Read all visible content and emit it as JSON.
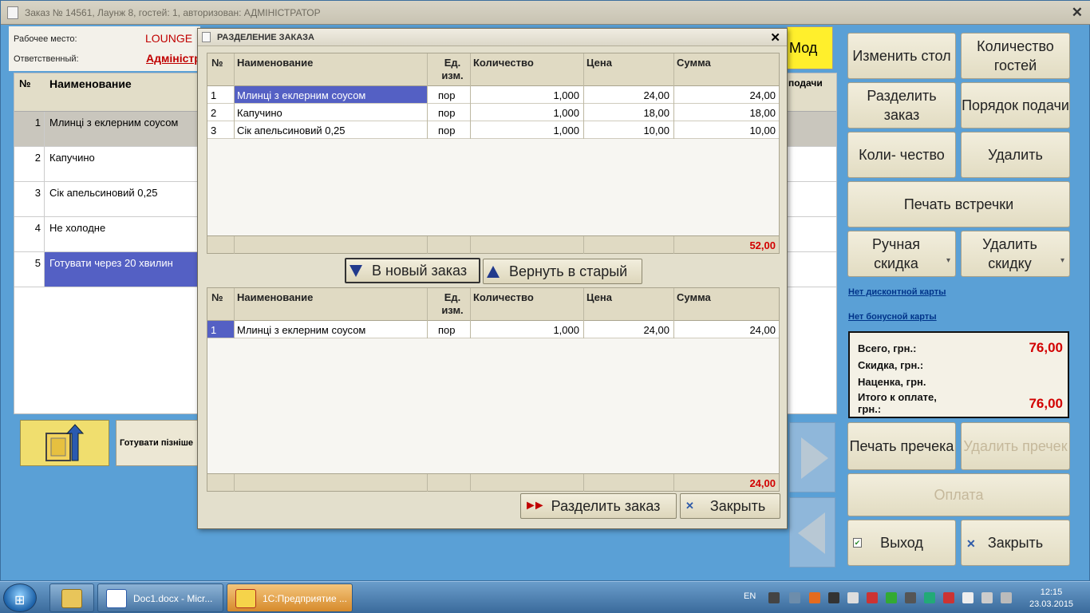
{
  "window": {
    "title": "Заказ № 14561, Лаунж 8, гостей: 1, авторизован: АДМІНІСТРАТОР",
    "workplace_label": "Рабочее место:",
    "workplace_value": "LOUNGE",
    "responsible_label": "Ответственный:",
    "responsible_value": "Адміністрат"
  },
  "order_table": {
    "col_num": "№",
    "col_name": "Наименование",
    "col_podachi": "подачи",
    "rows": [
      {
        "num": "1",
        "name": "Млинці з еклерним соусом"
      },
      {
        "num": "2",
        "name": "Капучино"
      },
      {
        "num": "3",
        "name": "Сік апельсиновий 0,25"
      },
      {
        "num": "4",
        "name": "Не холодне"
      },
      {
        "num": "5",
        "name": "Готувати через 20 хвилин"
      }
    ]
  },
  "left_buttons": {
    "prepare_later": "Готувати пізніше"
  },
  "right_panel": {
    "mod": "Мод",
    "change_table": "Изменить стол",
    "guest_count": "Количество гостей",
    "split_order": "Разделить заказ",
    "serving_order": "Порядок подачи",
    "quantity": "Коли- чество",
    "delete": "Удалить",
    "print_meeting": "Печать встречки",
    "manual_discount": "Ручная скидка",
    "remove_discount": "Удалить скидку",
    "no_discount_card": "Нет дисконтной карты",
    "no_bonus_card": "Нет бонусной карты",
    "print_precheck": "Печать пречека",
    "delete_precheck": "Удалить пречек",
    "payment": "Оплата",
    "exit": "Выход",
    "close": "Закрыть"
  },
  "totals": {
    "total_label": "Всего, грн.:",
    "total_value": "76,00",
    "discount_label": "Скидка, грн.:",
    "markup_label": "Наценка, грн.",
    "to_pay_label": "Итого к оплате, грн.:",
    "to_pay_value": "76,00"
  },
  "dialog": {
    "title": "РАЗДЕЛЕНИЕ ЗАКАЗА",
    "columns": {
      "num": "№",
      "name": "Наименование",
      "unit": "Ед. изм.",
      "qty": "Количество",
      "price": "Цена",
      "sum": "Сумма"
    },
    "upper_rows": [
      {
        "num": "1",
        "name": "Млинці з еклерним соусом",
        "unit": "пор",
        "qty": "1,000",
        "price": "24,00",
        "sum": "24,00"
      },
      {
        "num": "2",
        "name": "Капучино",
        "unit": "пор",
        "qty": "1,000",
        "price": "18,00",
        "sum": "18,00"
      },
      {
        "num": "3",
        "name": "Сік апельсиновий 0,25",
        "unit": "пор",
        "qty": "1,000",
        "price": "10,00",
        "sum": "10,00"
      }
    ],
    "upper_total": "52,00",
    "to_new_order": "В новый заказ",
    "return_to_old": "Вернуть в старый",
    "lower_rows": [
      {
        "num": "1",
        "name": "Млинці з еклерним соусом",
        "unit": "пор",
        "qty": "1,000",
        "price": "24,00",
        "sum": "24,00"
      }
    ],
    "lower_total": "24,00",
    "split_button": "Разделить заказ",
    "close_button": "Закрыть"
  },
  "taskbar": {
    "word_task": "Doc1.docx - Micr...",
    "onec_task": "1С:Предприятие ...",
    "lang": "EN",
    "time": "12:15",
    "date": "23.03.2015"
  }
}
